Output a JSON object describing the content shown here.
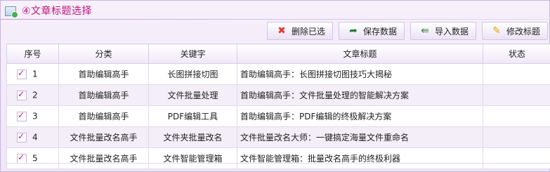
{
  "panel": {
    "title": "④文章标题选择"
  },
  "toolbar": {
    "buttons": [
      {
        "label": "删除已选",
        "icon": "delete-x-icon"
      },
      {
        "label": "保存数据",
        "icon": "save-icon"
      },
      {
        "label": "导入数据",
        "icon": "import-icon"
      },
      {
        "label": "修改标题",
        "icon": "edit-title-icon"
      }
    ]
  },
  "table": {
    "headers": [
      "序号",
      "分类",
      "关键字",
      "文章标题",
      "状态"
    ],
    "rows": [
      {
        "no": "1",
        "category": "首助编辑高手",
        "keyword": "长图拼接切图",
        "title": "首助编辑高手：长图拼接切图技巧大揭秘",
        "status": ""
      },
      {
        "no": "2",
        "category": "首助编辑高手",
        "keyword": "文件批量处理",
        "title": "首助编辑高手：文件批量处理的智能解决方案",
        "status": ""
      },
      {
        "no": "3",
        "category": "首助编辑高手",
        "keyword": "PDF编辑工具",
        "title": "首助编辑高手：PDF编辑的终极解决方案",
        "status": ""
      },
      {
        "no": "4",
        "category": "文件批量改名高手",
        "keyword": "文件夹批量改名",
        "title": "文件批量改名大师：一键搞定海量文件重命名",
        "status": ""
      },
      {
        "no": "5",
        "category": "文件批量改名高手",
        "keyword": "文件智能管理箱",
        "title": "文件智能管理箱：批量改名高手的终极利器",
        "status": ""
      }
    ]
  },
  "colors": {
    "accent": "#c0167c",
    "border": "#c9b3dc",
    "row_alt": "#f3eef8"
  }
}
